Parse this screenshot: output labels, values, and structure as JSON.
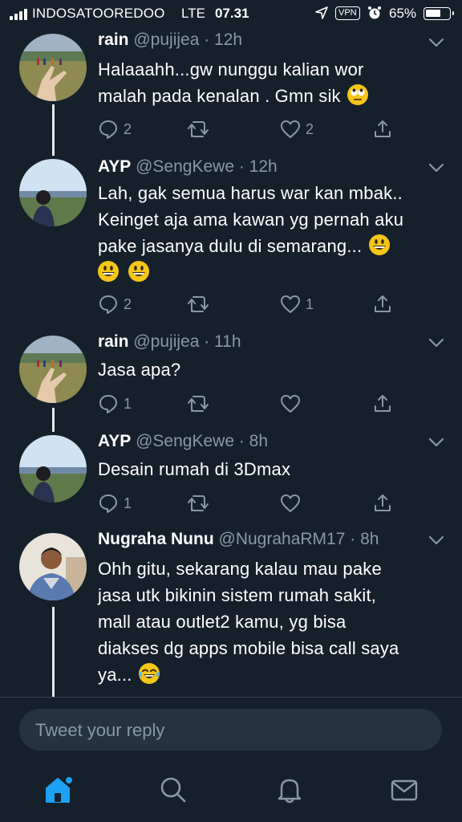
{
  "status_bar": {
    "carrier": "INDOSATOOREDOO",
    "network": "LTE",
    "time": "07.31",
    "vpn": "VPN",
    "battery": "65%",
    "battery_level": 0.65
  },
  "tweets": [
    {
      "name": "rain",
      "handle": "@pujijea",
      "time": "· 12h",
      "lines": [
        "Halaaahh...gw nunggu kalian wor",
        "malah pada kenalan . Gmn sik"
      ],
      "reply_count": "2",
      "like_count": "2",
      "avatar": "field-hand-photo",
      "trailing_emoji": "face-with-rolling-eyes"
    },
    {
      "name": "AYP",
      "handle": "@SengKewe",
      "time": "· 12h",
      "lines": [
        "Lah, gak semua harus war kan mbak..",
        "Keinget aja ama kawan yg pernah aku",
        "pake jasanya dulu di semarang..."
      ],
      "reply_count": "2",
      "like_count": "1",
      "avatar": "sky-landscape-photo",
      "trailing_emoji": "grinning-face"
    },
    {
      "name": "rain",
      "handle": "@pujijea",
      "time": "· 11h",
      "lines": [
        "Jasa apa?"
      ],
      "reply_count": "1",
      "like_count": "",
      "avatar": "field-hand-photo"
    },
    {
      "name": "AYP",
      "handle": "@SengKewe",
      "time": "· 8h",
      "lines": [
        "Desain rumah di 3Dmax"
      ],
      "reply_count": "1",
      "like_count": "",
      "avatar": "sky-landscape-photo"
    },
    {
      "name": "Nugraha Nunu",
      "handle": "@NugrahaRM17",
      "time": "· 8h",
      "lines": [
        "Ohh gitu, sekarang kalau mau pake",
        "jasa utk bikinin sistem rumah sakit,",
        "mall atau outlet2 kamu, yg bisa",
        "diakses dg apps mobile  bisa call saya",
        "ya..."
      ],
      "avatar": "portrait-photo",
      "trailing_emoji": "face-with-tears-of-joy"
    }
  ],
  "reply_bar": {
    "placeholder": "Tweet your reply"
  },
  "tab_bar": {
    "tabs": [
      "home-icon",
      "search-icon",
      "notifications-bell-icon",
      "messages-envelope-icon"
    ],
    "active": "home-icon",
    "accent_color": "#1da1f2"
  },
  "colors": {
    "background": "#15202b",
    "secondary_text": "#8899a6",
    "input_background": "#253341",
    "emoji_yellow": "#f5c518"
  }
}
